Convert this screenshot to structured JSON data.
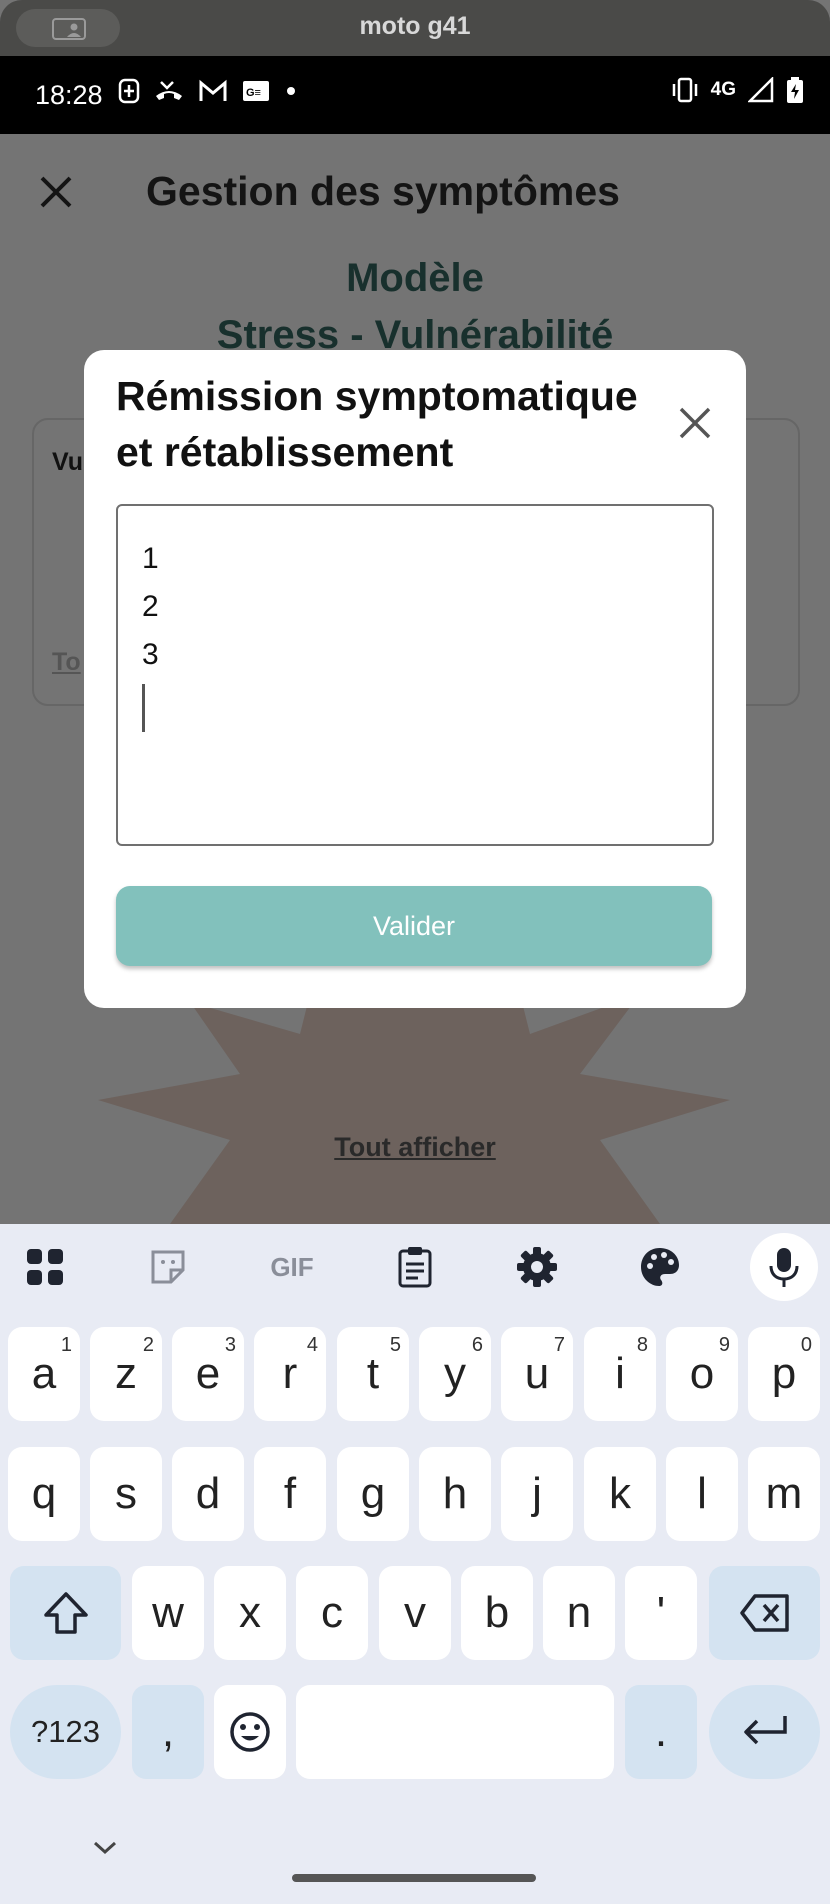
{
  "device": {
    "name": "moto g41"
  },
  "status_bar": {
    "time": "18:28",
    "network": "4G"
  },
  "app": {
    "title": "Gestion des symptômes",
    "model_line1": "Modèle",
    "model_line2": "Stress - Vulnérabilité",
    "card_text": "Vu ps",
    "card_link": "To",
    "show_all_link": "Tout afficher"
  },
  "modal": {
    "title": "Rémission symptomatique et rétablissement",
    "textarea_lines": [
      "1",
      "2",
      "3"
    ],
    "submit_label": "Valider"
  },
  "keyboard": {
    "toolbar": [
      "apps-icon",
      "sticker-icon",
      "gif-icon",
      "clipboard-icon",
      "settings-icon",
      "palette-icon",
      "mic-icon"
    ],
    "gif_label": "GIF",
    "row1": [
      {
        "k": "a",
        "h": "1"
      },
      {
        "k": "z",
        "h": "2"
      },
      {
        "k": "e",
        "h": "3"
      },
      {
        "k": "r",
        "h": "4"
      },
      {
        "k": "t",
        "h": "5"
      },
      {
        "k": "y",
        "h": "6"
      },
      {
        "k": "u",
        "h": "7"
      },
      {
        "k": "i",
        "h": "8"
      },
      {
        "k": "o",
        "h": "9"
      },
      {
        "k": "p",
        "h": "0"
      }
    ],
    "row2": [
      "q",
      "s",
      "d",
      "f",
      "g",
      "h",
      "j",
      "k",
      "l",
      "m"
    ],
    "row3": [
      "w",
      "x",
      "c",
      "v",
      "b",
      "n",
      "'"
    ],
    "symbols_label": "?123",
    "comma": ",",
    "period": "."
  }
}
